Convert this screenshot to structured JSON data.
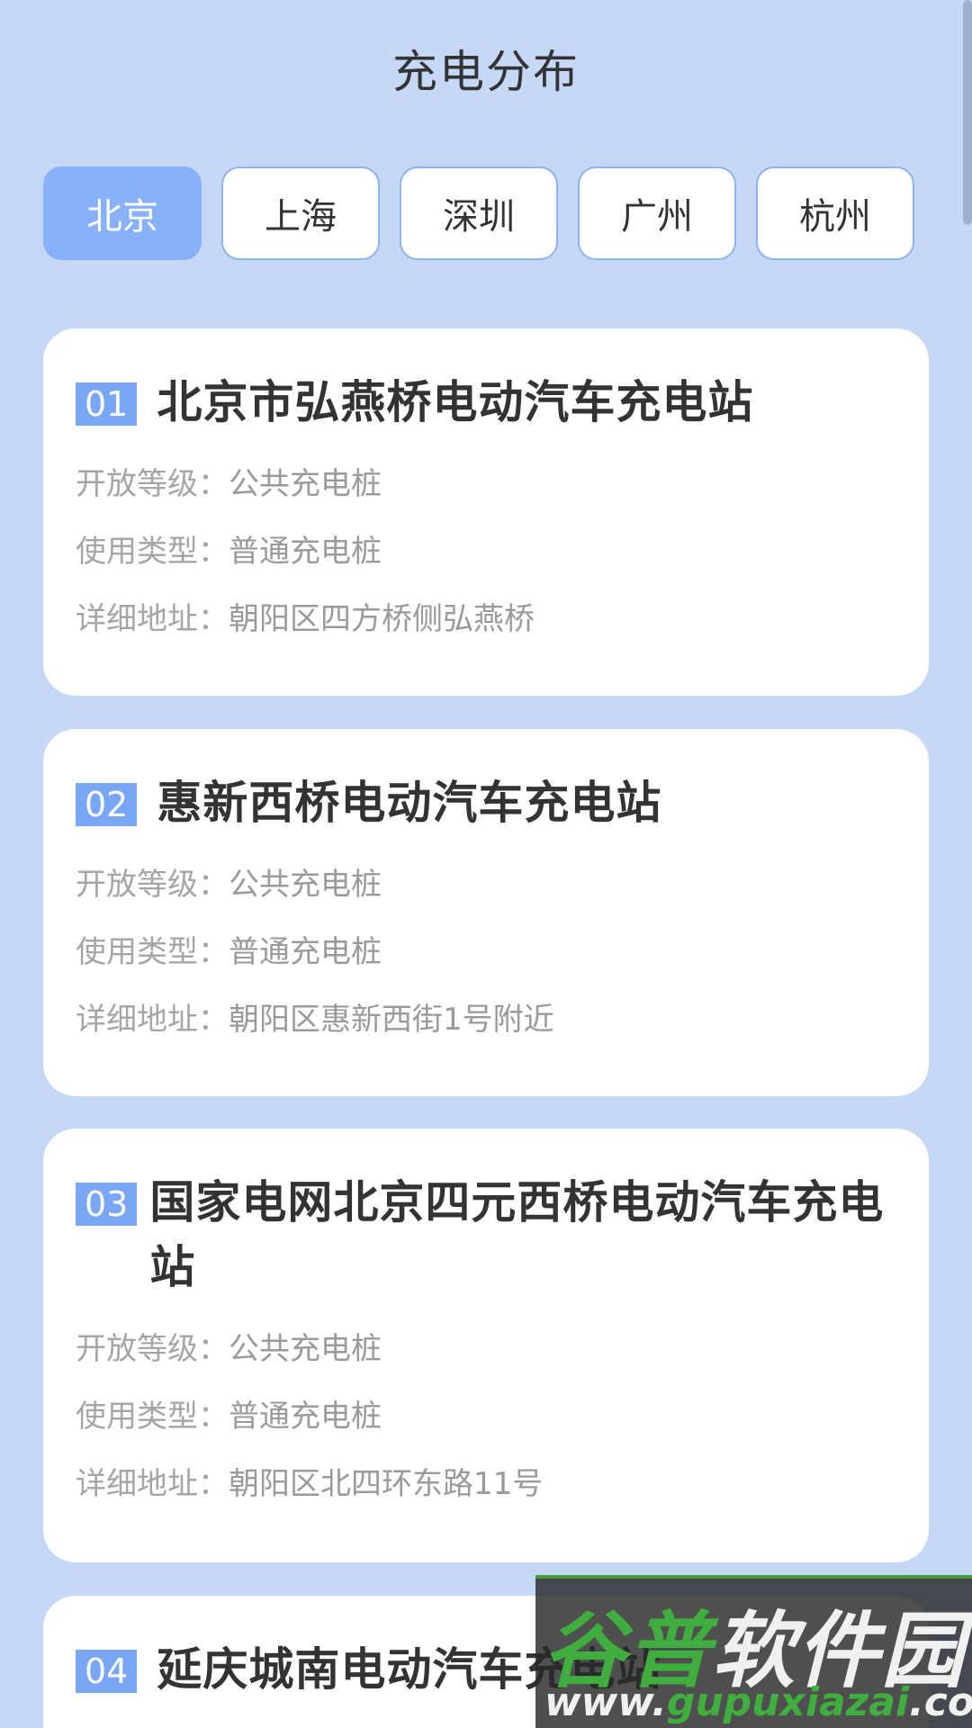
{
  "header": {
    "title": "充电分布"
  },
  "tabs": [
    {
      "label": "北京",
      "active": true
    },
    {
      "label": "上海",
      "active": false
    },
    {
      "label": "深圳",
      "active": false
    },
    {
      "label": "广州",
      "active": false
    },
    {
      "label": "杭州",
      "active": false
    }
  ],
  "labels": {
    "level": "开放等级：",
    "type": "使用类型：",
    "address": "详细地址："
  },
  "stations": [
    {
      "num": "01",
      "name": "北京市弘燕桥电动汽车充电站",
      "level": "公共充电桩",
      "type": "普通充电桩",
      "address": "朝阳区四方桥侧弘燕桥"
    },
    {
      "num": "02",
      "name": "惠新西桥电动汽车充电站",
      "level": "公共充电桩",
      "type": "普通充电桩",
      "address": "朝阳区惠新西街1号附近"
    },
    {
      "num": "03",
      "name": "国家电网北京四元西桥电动汽车充电站",
      "level": "公共充电桩",
      "type": "普通充电桩",
      "address": "朝阳区北四环东路11号"
    },
    {
      "num": "04",
      "name": "延庆城南电动汽车充电站"
    }
  ],
  "watermark": {
    "main_a": "谷普",
    "main_b": "软件园",
    "url_a": "www.",
    "url_b": "gupuxiazai",
    "url_c": ".com"
  },
  "colors": {
    "background": "#c6d8f8",
    "accent": "#88b1f9",
    "badge": "#7aa7f5"
  }
}
